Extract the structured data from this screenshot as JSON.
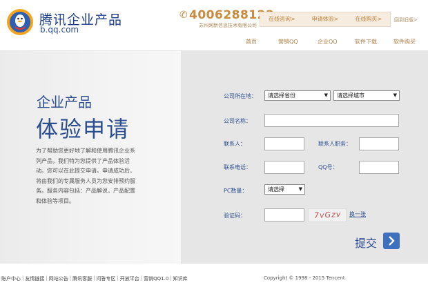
{
  "header": {
    "brand_title": "腾讯企业产品",
    "brand_domain": "b.qq.com",
    "phone": "4006288122",
    "phone_sub": "苏州网新信息技术有限公司",
    "top_actions": [
      "在线咨询>",
      "申请体验>",
      "在线购买>"
    ],
    "back_link": "回到旧版>"
  },
  "nav": [
    "首页",
    "营销QQ",
    "企业QQ",
    "软件下载",
    "软件购买"
  ],
  "hero": {
    "title1": "企业产品",
    "title2": "体验申请",
    "description": "为了帮助您更好地了解和使用腾讯企业系列产品，我们特为您提供了产品体验活动。您可以在此提交申请。申请成功后，将由我们的专属服务人员为您安排预约服务。服务内容包括：产品解说，产品配置和体验等项目。"
  },
  "form": {
    "location_label": "公司所在地：",
    "province_select": "请选择省份",
    "city_select": "请选择城市",
    "company_label": "公司名称：",
    "contact_label": "联系人：",
    "position_label": "联系人职务：",
    "phone_label": "联系电话：",
    "qq_label": "QQ号：",
    "pc_label": "PC数量：",
    "pc_select": "请选择",
    "captcha_label": "验证码：",
    "captcha_text": "7vGzv",
    "refresh_link": "换一张",
    "submit_label": "提交"
  },
  "footer": {
    "links": [
      "账户中心",
      "友情链接",
      "网站公告",
      "腾讯客服",
      "问答专区",
      "开放平台",
      "营销QQ1.0",
      "知识库"
    ],
    "copyright": "Copyright © 1998 - 2015 Tencent"
  },
  "colors": {
    "brand_blue": "#2a4d8f",
    "accent_orange": "#c98a3e",
    "submit_blue": "#3f6fbf"
  }
}
